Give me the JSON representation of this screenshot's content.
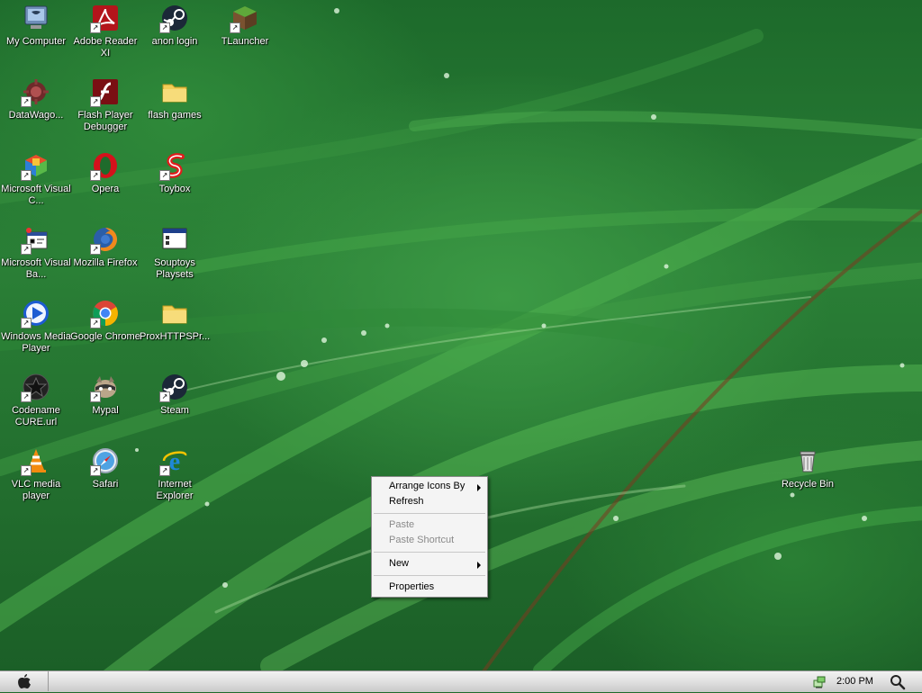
{
  "desktop": {
    "icons": [
      {
        "label": "My Computer",
        "icon": "computer-icon"
      },
      {
        "label": "Adobe Reader XI",
        "icon": "adobe-reader-icon"
      },
      {
        "label": "anon login",
        "icon": "steam-icon"
      },
      {
        "label": "TLauncher",
        "icon": "minecraft-block-icon"
      },
      {
        "label": "DataWago...",
        "icon": "datawagon-icon"
      },
      {
        "label": "Flash Player Debugger",
        "icon": "flash-player-icon"
      },
      {
        "label": "flash games",
        "icon": "folder-icon"
      },
      {
        "label": "Microsoft Visual C...",
        "icon": "visual-studio-icon"
      },
      {
        "label": "Opera",
        "icon": "opera-icon"
      },
      {
        "label": "Toybox",
        "icon": "toybox-icon"
      },
      {
        "label": "Microsoft Visual Ba...",
        "icon": "visual-basic-icon"
      },
      {
        "label": "Mozilla Firefox",
        "icon": "firefox-icon"
      },
      {
        "label": "Souptoys Playsets",
        "icon": "window-icon"
      },
      {
        "label": "Windows Media Player",
        "icon": "media-player-icon"
      },
      {
        "label": "Google Chrome",
        "icon": "chrome-icon"
      },
      {
        "label": "ProxHTTPSPr...",
        "icon": "folder-icon"
      },
      {
        "label": "Codename CURE.url",
        "icon": "codename-cure-icon"
      },
      {
        "label": "Mypal",
        "icon": "mypal-raccoon-icon"
      },
      {
        "label": "Steam",
        "icon": "steam-icon"
      },
      {
        "label": "VLC media player",
        "icon": "vlc-cone-icon"
      },
      {
        "label": "Safari",
        "icon": "safari-compass-icon"
      },
      {
        "label": "Internet Explorer",
        "icon": "internet-explorer-icon"
      },
      {
        "label": "Recycle Bin",
        "icon": "recycle-bin-icon"
      }
    ]
  },
  "context_menu": {
    "items": [
      {
        "label": "Arrange Icons By",
        "submenu": true,
        "enabled": true
      },
      {
        "label": "Refresh",
        "submenu": false,
        "enabled": true
      },
      {
        "label": "Paste",
        "submenu": false,
        "enabled": false
      },
      {
        "label": "Paste Shortcut",
        "submenu": false,
        "enabled": false
      },
      {
        "label": "New",
        "submenu": true,
        "enabled": true
      },
      {
        "label": "Properties",
        "submenu": false,
        "enabled": true
      }
    ]
  },
  "taskbar": {
    "start_icon": "apple-logo-icon",
    "tray_icon": "network-icon",
    "clock": "2:00 PM",
    "search_icon": "search-icon"
  }
}
